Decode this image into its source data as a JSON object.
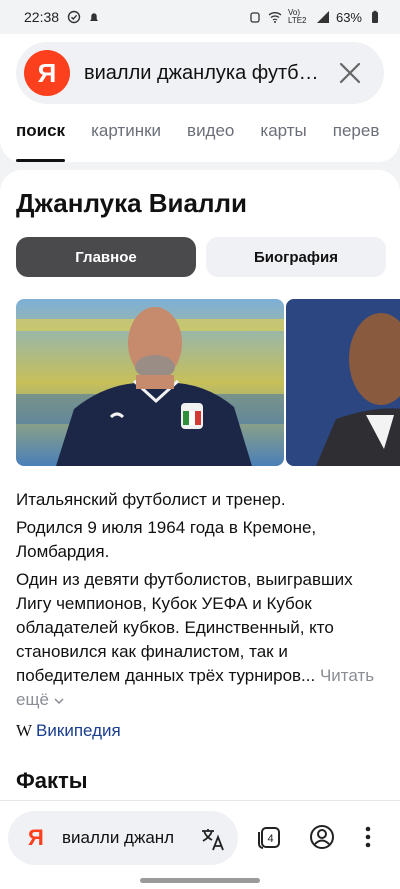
{
  "status_bar": {
    "time": "22:38",
    "battery": "63%",
    "network": "Vo) LTE2"
  },
  "search": {
    "logo": "Я",
    "query": "виалли джанлука футбо...",
    "clear_icon": "close-icon"
  },
  "tabs": [
    {
      "label": "поиск",
      "active": true
    },
    {
      "label": "картинки"
    },
    {
      "label": "видео"
    },
    {
      "label": "карты"
    },
    {
      "label": "перев"
    }
  ],
  "entity": {
    "title": "Джанлука Виалли",
    "pills": {
      "main": "Главное",
      "bio": "Биография"
    },
    "description": [
      "Итальянский футболист и тренер.",
      "Родился 9 июля 1964 года в Кремоне, Ломбардия.",
      "Один из девяти футболистов, выигравших Лигу чемпионов, Кубок УЕФА и Кубок обладателей кубков. Единственный, кто становился как финалистом, так и победителем данных трёх турниров..."
    ],
    "read_more": "Читать ещё",
    "wiki_letter": "W",
    "wiki_label": "Википедия",
    "facts_heading": "Факты"
  },
  "bottom_bar": {
    "logo": "Я",
    "query": "виалли джанл",
    "tab_count": "4"
  },
  "colors": {
    "brand": "#fc3f1d",
    "link": "#1a3d8f",
    "pill_active": "#4a4a4c"
  }
}
